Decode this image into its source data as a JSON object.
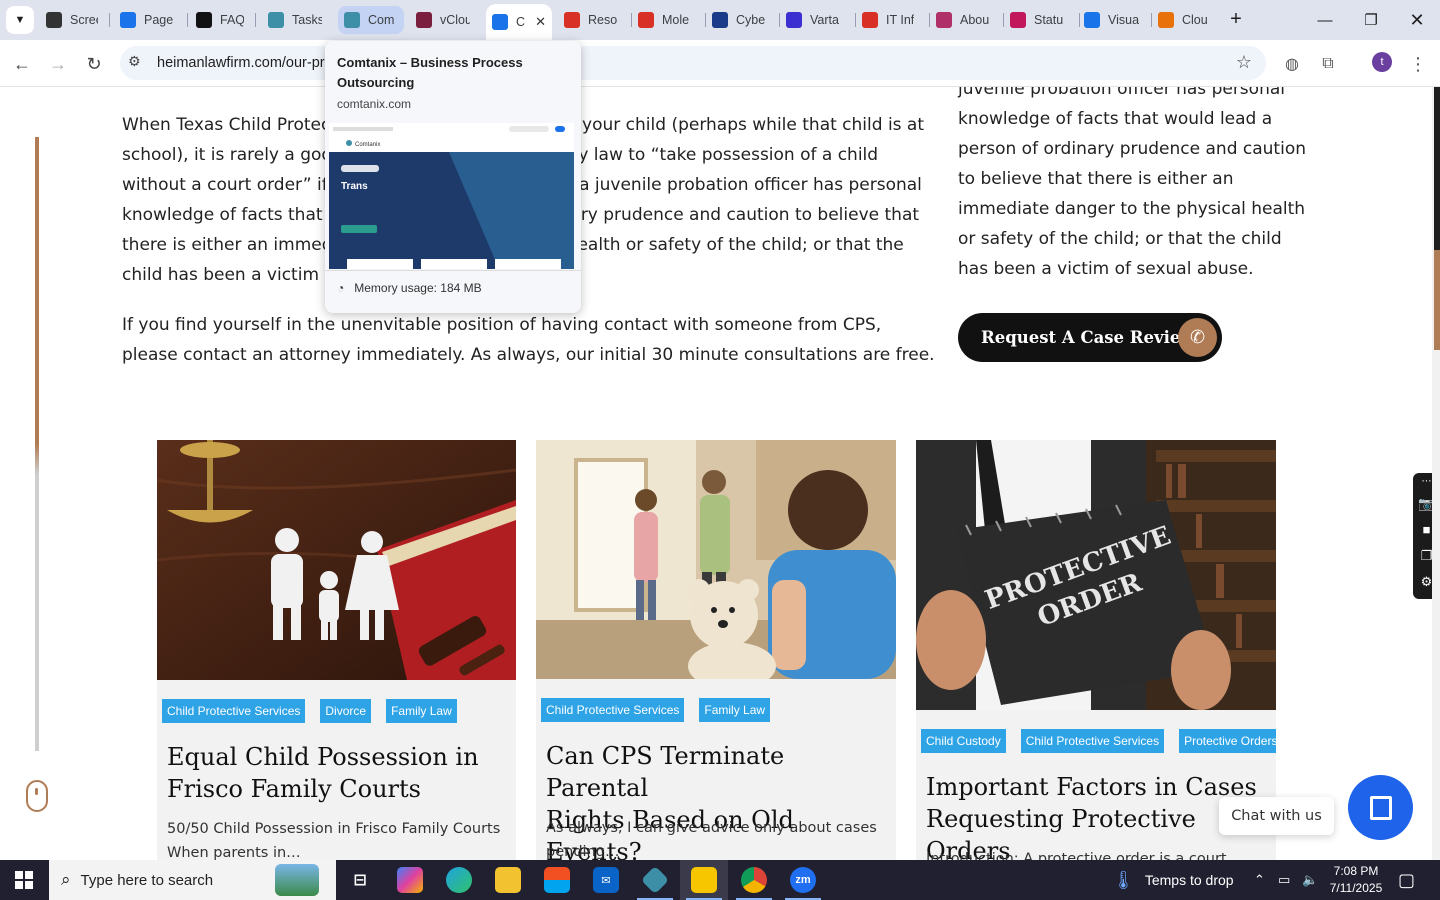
{
  "browser": {
    "tabs": [
      {
        "title": "Scree",
        "favicon": "obs-icon",
        "color": "#333333"
      },
      {
        "title": "Page",
        "favicon": "speed-gauge-icon",
        "color": "#1a73e8"
      },
      {
        "title": "FAQ",
        "favicon": "faq-logo-icon",
        "color": "#111111"
      },
      {
        "title": "Tasks",
        "favicon": "comtanix-icon",
        "color": "#3c8fa6"
      },
      {
        "title": "Com",
        "favicon": "comtanix-icon",
        "color": "#3c8fa6"
      },
      {
        "title": "vClou",
        "favicon": "v-logo-icon",
        "color": "#7a1f3d"
      },
      {
        "title": "C",
        "favicon": "scales-icon",
        "color": "#1a73e8"
      },
      {
        "title": "Reso",
        "favicon": "diamond-icon",
        "color": "#d93025"
      },
      {
        "title": "Mole",
        "favicon": "diamond-icon",
        "color": "#d93025"
      },
      {
        "title": "Cybe",
        "favicon": "check-logo-icon",
        "color": "#1a3a8a"
      },
      {
        "title": "Varta",
        "favicon": "x-logo-icon",
        "color": "#3b2fd1"
      },
      {
        "title": "IT Inf",
        "favicon": "diamond-icon",
        "color": "#d93025"
      },
      {
        "title": "Abou",
        "favicon": "flower-icon",
        "color": "#b0306a"
      },
      {
        "title": "Statu",
        "favicon": "pen-icon",
        "color": "#c2185b"
      },
      {
        "title": "Visua",
        "favicon": "pulse-icon",
        "color": "#1a73e8"
      },
      {
        "title": "Clou",
        "favicon": "swoosh-icon",
        "color": "#e8710a"
      }
    ],
    "url": "heimanlawfirm.com/our-pr",
    "hover_card": {
      "title": "Comtanix – Business Process Outsourcing",
      "domain": "comtanix.com",
      "thumb_brand": "Comtanix",
      "thumb_hero": "Trans",
      "memory": "Memory usage: 184 MB"
    },
    "profile_initial": "t"
  },
  "page": {
    "para1": "When Texas Child Protective Services contacts you or your child (perhaps while that child is at school), it is rarely a good thing. CPS has the power by law to “take possession of a child without a court order” if a law enforcement officer or a juvenile probation officer has personal knowledge of facts that would lead a person of ordinary prudence and caution to believe that there is either an immediate danger to the physical health or safety of the child; or that the child has been a victim of sexual abuse.",
    "para2": "If you find yourself in the unenvitable position of having contact with someone from CPS, please contact an attorney immediately. As always, our initial 30 minute consultations are free.",
    "right_text": "juvenile probation officer has personal knowledge of facts that would lead a person of ordinary prudence and caution to believe that there is either an immediate danger to the physical health or safety of the child; or that the child has been a victim of sexual abuse.",
    "cta_label": "Request A Case Review",
    "cards": [
      {
        "tags": [
          "Child Protective Services",
          "Divorce",
          "Family Law"
        ],
        "title": "Equal Child Possession in\nFrisco Family Courts",
        "excerpt": "50/50 Child Possession in Frisco Family Courts\nWhen parents in…"
      },
      {
        "tags": [
          "Child Protective Services",
          "Family Law"
        ],
        "title": "Can CPS Terminate Parental\nRights Based on Old Events?",
        "excerpt": "As always, I can give advice only about cases\npending…"
      },
      {
        "tags": [
          "Child Custody",
          "Child Protective Services",
          "Protective Orders"
        ],
        "title": "Important Factors in Cases\nRequesting Protective Orders",
        "excerpt": "Introduction: A protective order is a court order"
      }
    ],
    "card3_image_text": "PROTECTIVE\nORDER",
    "chat_label": "Chat with us"
  },
  "taskbar": {
    "search_placeholder": "Type here to search",
    "weather": "Temps to drop",
    "time": "7:08 PM",
    "date": "7/11/2025",
    "zoom_label": "zm"
  }
}
